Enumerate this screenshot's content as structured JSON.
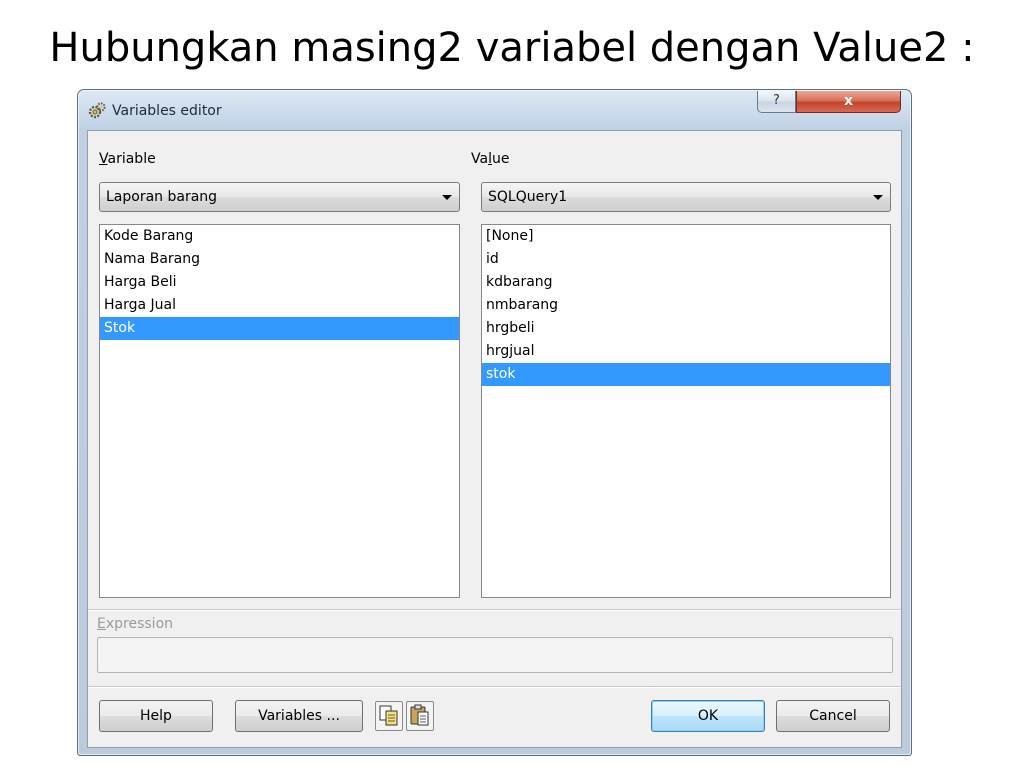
{
  "slide": {
    "title": "Hubungkan masing2 variabel dengan Value2 :"
  },
  "window": {
    "title": "Variables editor",
    "help_glyph": "?",
    "close_glyph": "x",
    "icon": "gear-icon"
  },
  "variable": {
    "label_underline": "V",
    "label_rest": "ariable",
    "combo_value": "Laporan barang",
    "items": [
      "Kode Barang",
      "Nama Barang",
      "Harga Beli",
      "Harga Jual",
      "Stok"
    ],
    "selected_index": 4
  },
  "value": {
    "label_before": "Va",
    "label_underline": "l",
    "label_after": "ue",
    "combo_value": "SQLQuery1",
    "items": [
      "[None]",
      "id",
      "kdbarang",
      "nmbarang",
      "hrgbeli",
      "hrgjual",
      "stok"
    ],
    "selected_index": 6
  },
  "expression": {
    "label_underline": "E",
    "label_rest": "xpression",
    "value": ""
  },
  "buttons": {
    "help": "Help",
    "variables": "Variables ...",
    "ok": "OK",
    "cancel": "Cancel"
  },
  "colors": {
    "selection": "#3399ff",
    "close_button": "#c4432c"
  }
}
